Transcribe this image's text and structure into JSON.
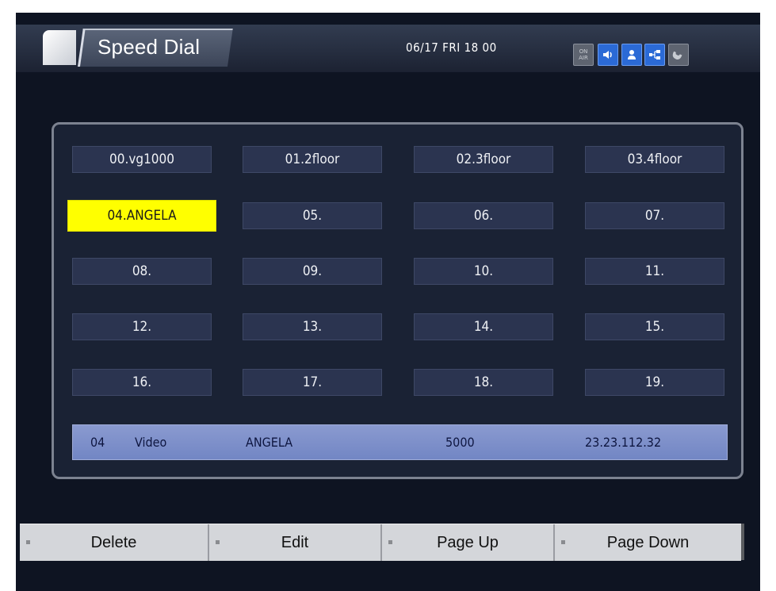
{
  "header": {
    "title": "Speed Dial",
    "datetime": "06/17 FRI 18 00",
    "status_icons": [
      {
        "name": "on-air-icon",
        "text": "ON AIR"
      },
      {
        "name": "speaker-icon"
      },
      {
        "name": "person-icon"
      },
      {
        "name": "network-icon"
      },
      {
        "name": "phone-icon"
      }
    ]
  },
  "speed_dial": {
    "entries": [
      "00.vg1000",
      "01.2floor",
      "02.3floor",
      "03.4floor",
      "04.ANGELA",
      "05.",
      "06.",
      "07.",
      "08.",
      "09.",
      "10.",
      "11.",
      "12.",
      "13.",
      "14.",
      "15.",
      "16.",
      "17.",
      "18.",
      "19."
    ],
    "selected_index": 4
  },
  "detail": {
    "index": "04",
    "type": "Video",
    "name": "ANGELA",
    "number": "5000",
    "address": "23.23.112.32"
  },
  "footer": {
    "buttons": [
      "Delete",
      "Edit",
      "Page Up",
      "Page Down"
    ]
  },
  "colors": {
    "selected": "#ffff00",
    "cell": "#2b3450",
    "detail_bar": "#7c8ec8",
    "status_active": "#2b6ad6"
  }
}
